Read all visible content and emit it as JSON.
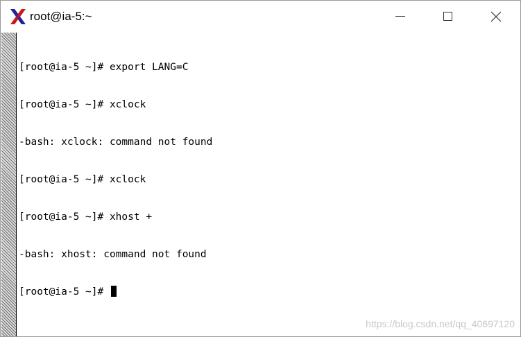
{
  "window": {
    "title": "root@ia-5:~",
    "icon": "xterm-x-icon",
    "controls": [
      "minimize",
      "maximize",
      "close"
    ]
  },
  "terminal": {
    "lines": [
      "[root@ia-5 ~]# export LANG=C",
      "[root@ia-5 ~]# xclock",
      "-bash: xclock: command not found",
      "[root@ia-5 ~]# xclock",
      "[root@ia-5 ~]# xhost +",
      "-bash: xhost: command not found",
      "[root@ia-5 ~]# "
    ]
  },
  "watermark": "https://blog.csdn.net/qq_40697120"
}
